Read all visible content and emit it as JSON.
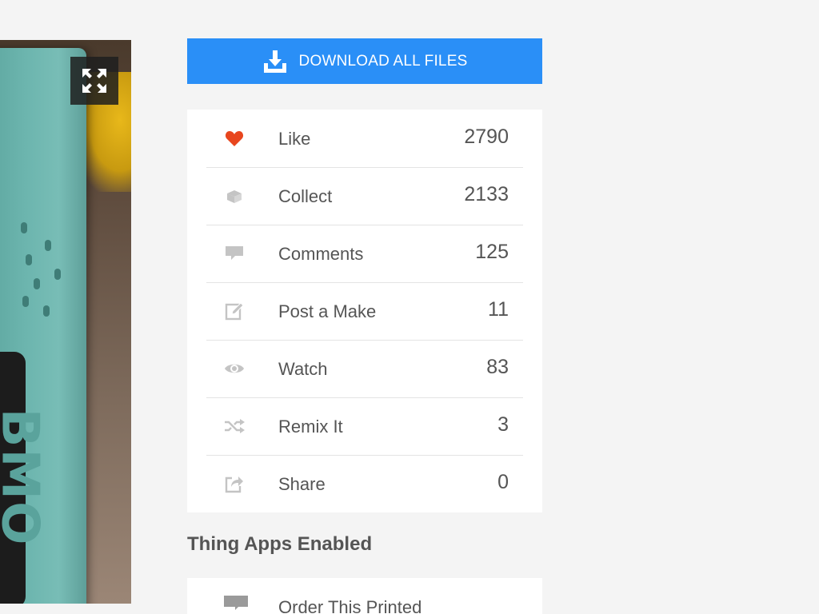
{
  "colors": {
    "accent": "#2a8ff7",
    "like_icon": "#e8461e",
    "icon_grey": "#bdbdbd",
    "text": "#555555"
  },
  "download": {
    "label": "DOWNLOAD ALL FILES",
    "icon": "download-icon"
  },
  "photo": {
    "expand_icon": "expand-icon",
    "device_text": "BMO"
  },
  "stats": [
    {
      "label": "Like",
      "count": "2790",
      "icon": "heart-icon"
    },
    {
      "label": "Collect",
      "count": "2133",
      "icon": "collect-icon"
    },
    {
      "label": "Comments",
      "count": "125",
      "icon": "comment-icon"
    },
    {
      "label": "Post a Make",
      "count": "11",
      "icon": "edit-icon"
    },
    {
      "label": "Watch",
      "count": "83",
      "icon": "eye-icon"
    },
    {
      "label": "Remix It",
      "count": "3",
      "icon": "shuffle-icon"
    },
    {
      "label": "Share",
      "count": "0",
      "icon": "share-icon"
    }
  ],
  "apps_section": {
    "title": "Thing Apps Enabled",
    "items": [
      {
        "label": "Order This Printed",
        "icon": "print-icon"
      }
    ]
  }
}
